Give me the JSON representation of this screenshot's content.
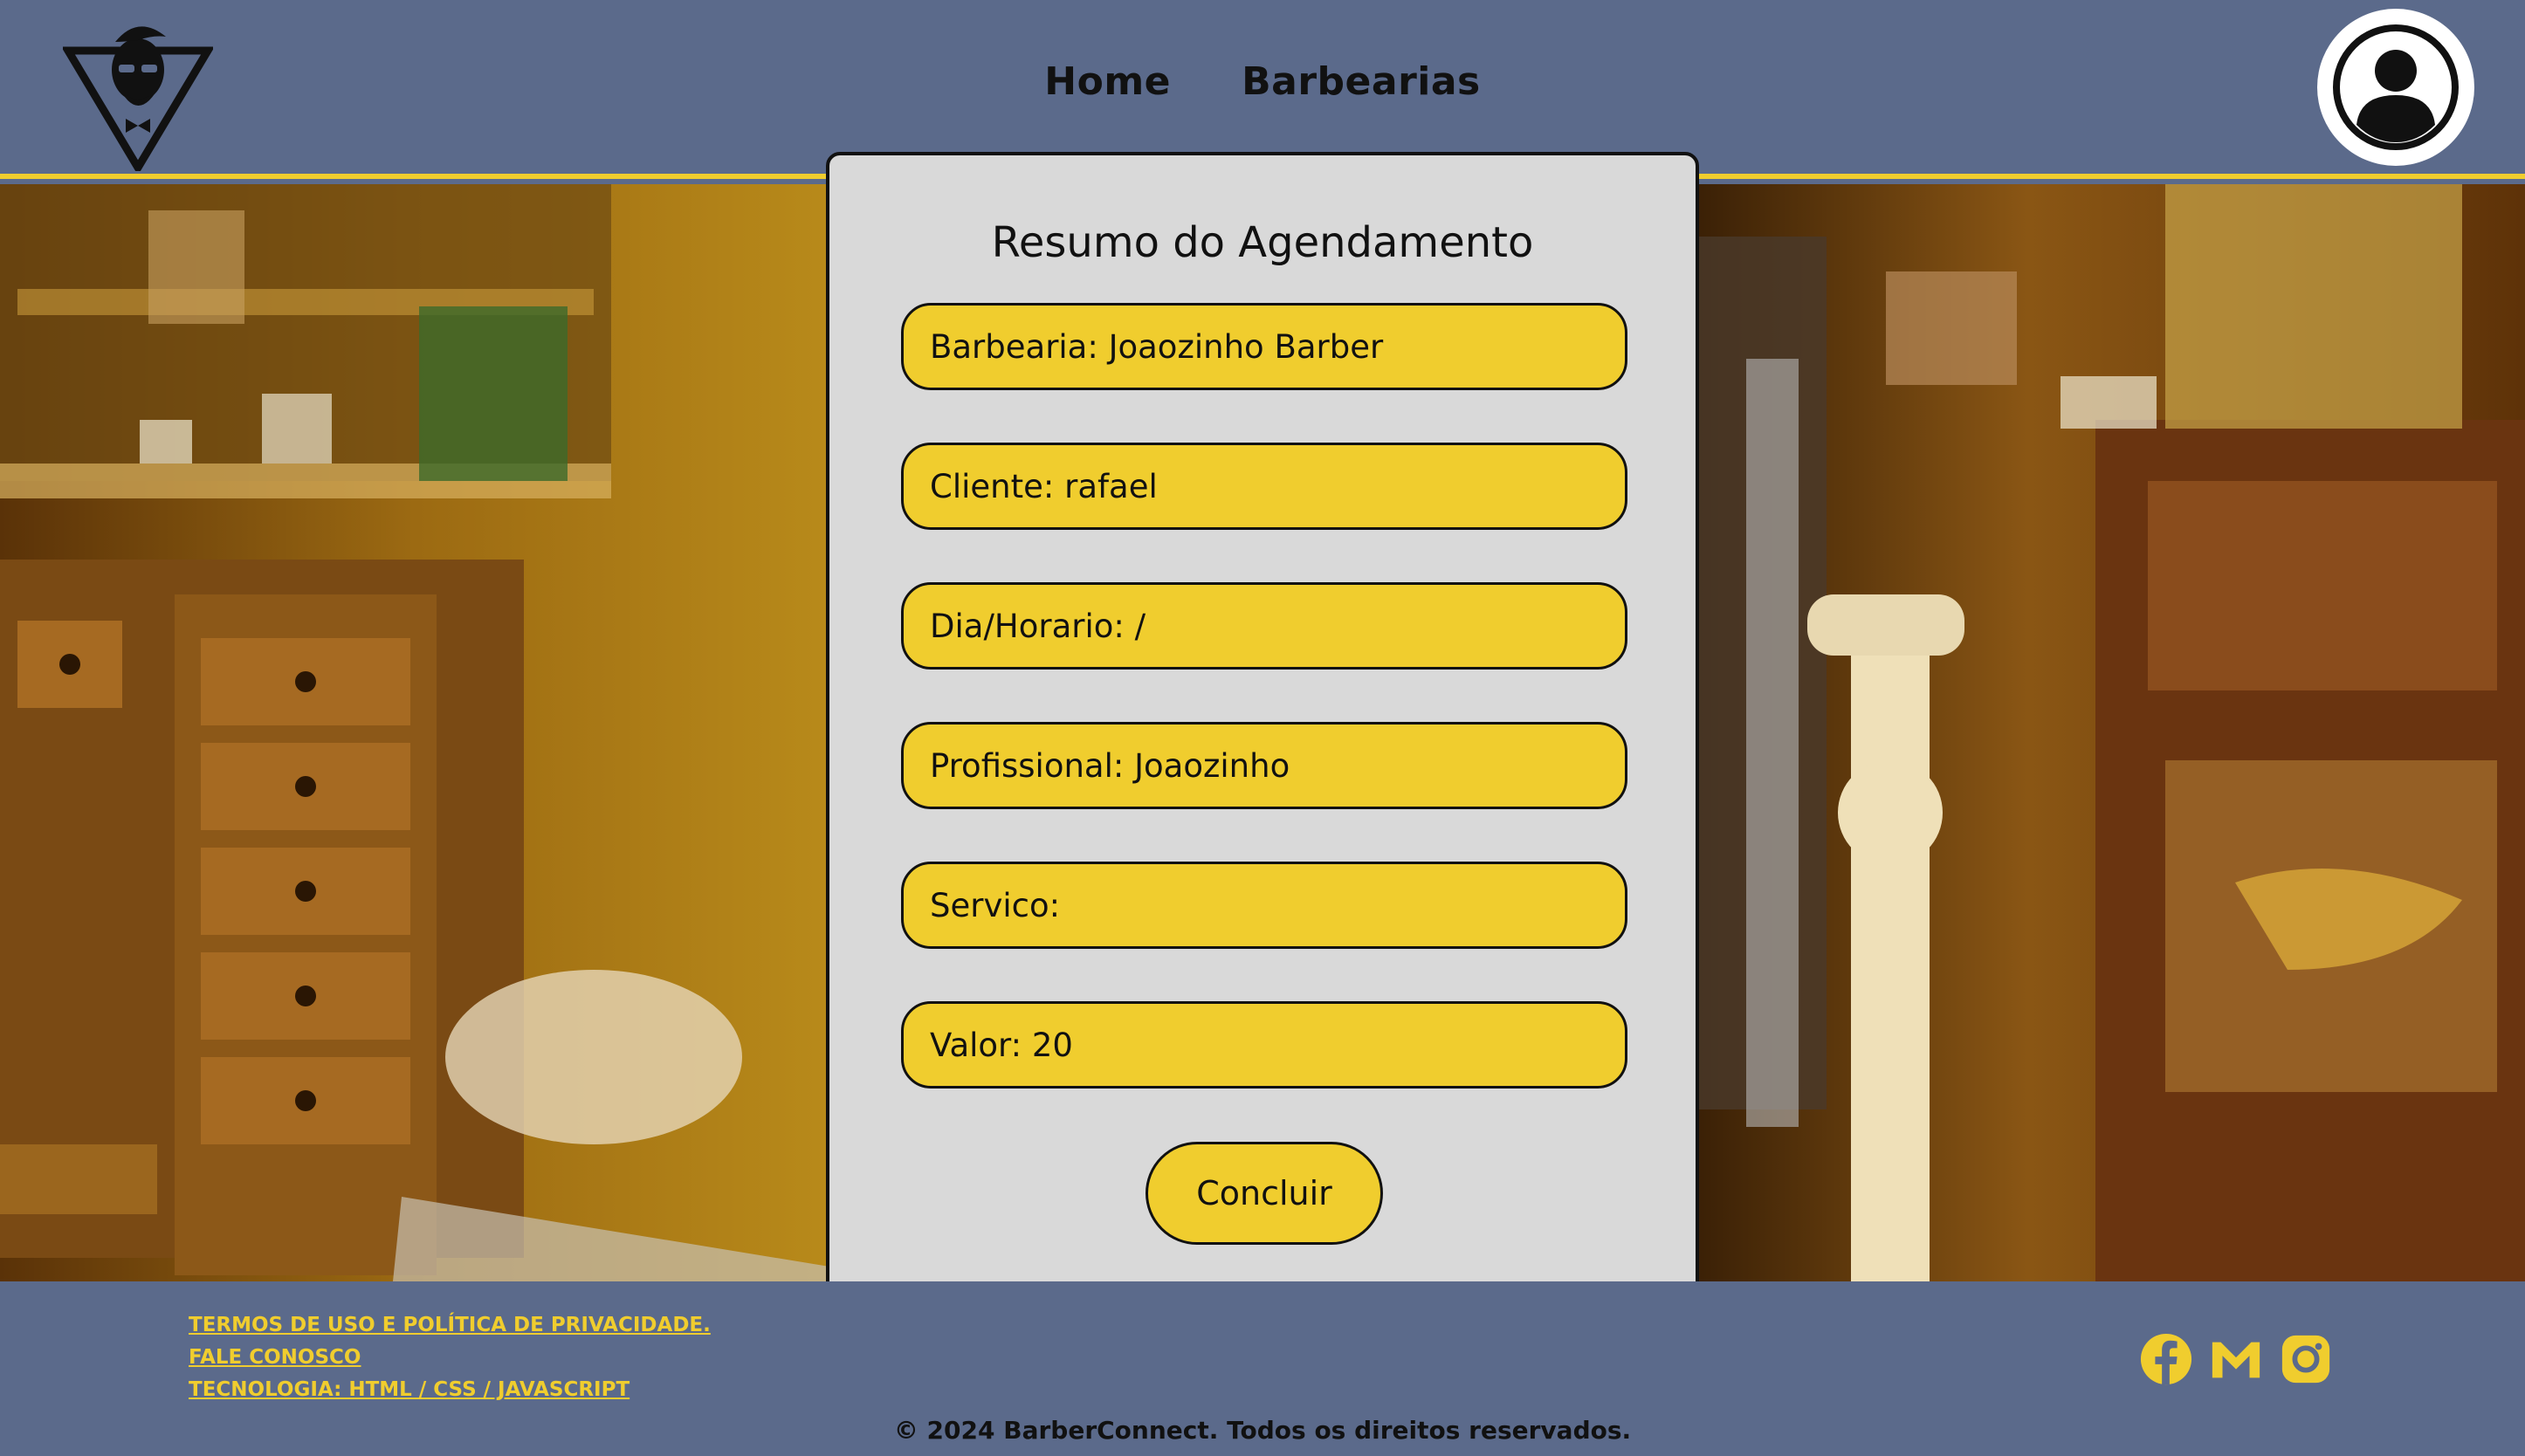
{
  "header": {
    "nav": [
      {
        "label": "Home"
      },
      {
        "label": "Barbearias"
      }
    ]
  },
  "summary": {
    "title": "Resumo do Agendamento",
    "fields": [
      {
        "text": "Barbearia: Joaozinho Barber"
      },
      {
        "text": "Cliente: rafael"
      },
      {
        "text": "Dia/Horario: /"
      },
      {
        "text": "Profissional: Joaozinho"
      },
      {
        "text": "Servico:"
      },
      {
        "text": "Valor: 20"
      }
    ],
    "button_label": "Concluir"
  },
  "footer": {
    "links": [
      {
        "label": "TERMOS DE USO E POLÍTICA DE PRIVACIDADE."
      },
      {
        "label": "FALE CONOSCO"
      },
      {
        "label": "TECNOLOGIA: HTML / CSS / JAVASCRIPT"
      }
    ],
    "social_icons": [
      "facebook-icon",
      "gmail-icon",
      "instagram-icon"
    ],
    "copyright": "© 2024 BarberConnect. Todos os direitos reservados."
  },
  "colors": {
    "header_bg": "#5b6a8b",
    "accent": "#f0cd2e",
    "card_bg": "#d9d9d9"
  }
}
